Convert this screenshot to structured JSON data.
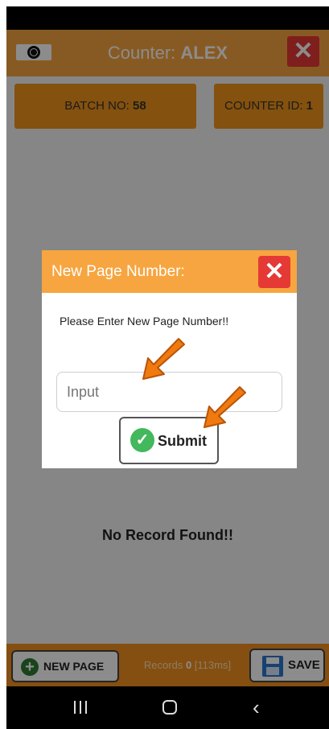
{
  "header": {
    "title_prefix": "Counter: ",
    "title_name": "ALEX",
    "close_symbol": "✕"
  },
  "info": {
    "batch_label": "BATCH NO: ",
    "batch_value": "58",
    "counter_label": "COUNTER ID: ",
    "counter_value": "1"
  },
  "main": {
    "empty_message": "No Record Found!!"
  },
  "footer": {
    "new_page_label": "NEW PAGE",
    "records_prefix": "Records ",
    "records_count": "0",
    "records_time": " [113ms]",
    "save_label": "SAVE"
  },
  "dialog": {
    "title": "New Page Number:",
    "close_symbol": "✕",
    "message": "Please Enter New Page Number!!",
    "input_placeholder": "Input",
    "submit_label": "Submit",
    "check_symbol": "✓"
  },
  "navbar": {
    "back_symbol": "‹"
  },
  "colors": {
    "accent_orange": "#f7a540",
    "close_red": "#e53935",
    "annotation_arrow": "#f07a10"
  },
  "icons": [
    "globe-icon",
    "close-icon",
    "plus-icon",
    "save-icon",
    "check-icon",
    "recents-icon",
    "home-icon",
    "back-icon",
    "arrow-annotation-icon"
  ]
}
